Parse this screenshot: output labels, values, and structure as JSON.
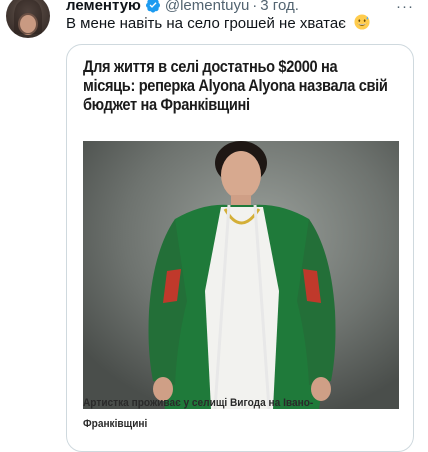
{
  "tweet": {
    "author_name": "лементую",
    "author_handle": "@lementuyu",
    "separator": "·",
    "timestamp": "3 год.",
    "text": "В мене навіть на село грошей не хватає",
    "verified_icon": "verified-badge-icon",
    "emoji_icon": "grinning-sweat-emoji-icon",
    "more_icon": "more-options-icon",
    "more_glyph": "···"
  },
  "card": {
    "headline": "Для життя в селі достатньо $2000 на місяць: реперка Alyona Alyona назвала свій бюджет на Франківщині",
    "image_alt": "performer-portrait-photo",
    "caption": "Артистка проживає у селищі Вигода на Івано-Франківщині"
  },
  "colors": {
    "verified": "#1d9bf0",
    "secondary_text": "#536471",
    "border": "#cfd9de",
    "jacket_green": "#1f7a3a",
    "jacket_red": "#c0392b"
  }
}
